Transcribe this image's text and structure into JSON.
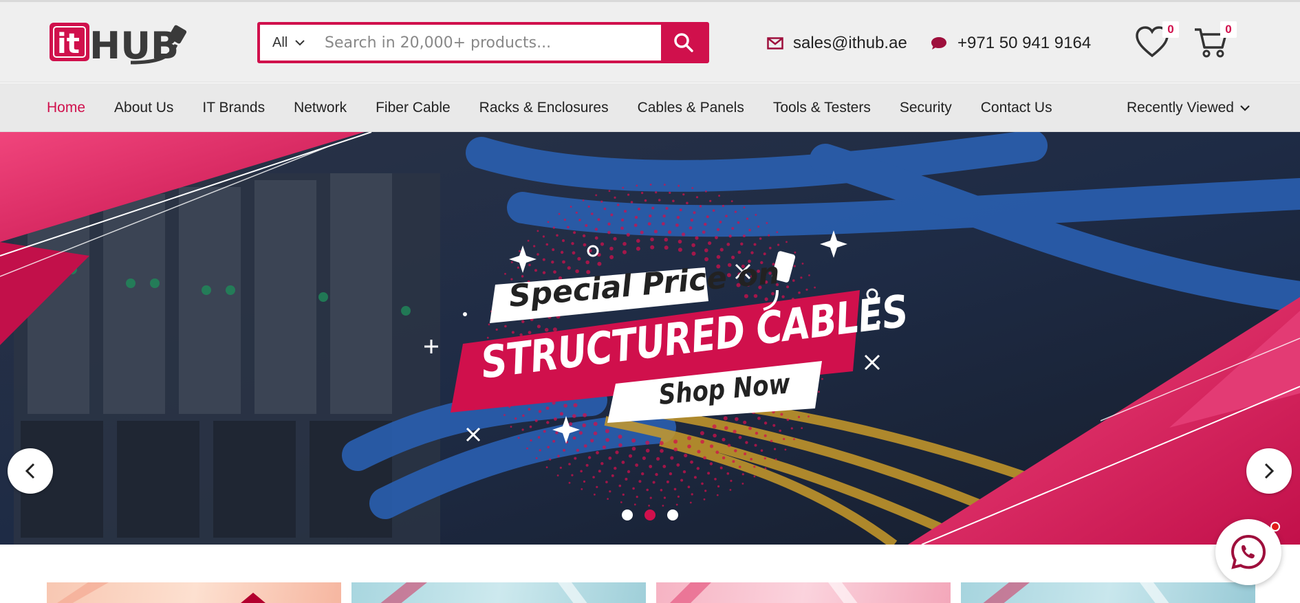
{
  "brand": {
    "logo_text_it": "it",
    "logo_text_hub": "HUB",
    "accent": "#d0104c"
  },
  "search": {
    "category": "All",
    "placeholder": "Search in 20,000+ products...",
    "value": ""
  },
  "contact": {
    "email": "sales@ithub.ae",
    "phone": "+971 50 941 9164"
  },
  "wishlist": {
    "count": "0",
    "icon": "heart-icon"
  },
  "cart": {
    "count": "0",
    "icon": "cart-icon"
  },
  "nav": {
    "items": [
      {
        "label": "Home",
        "active": true
      },
      {
        "label": "About Us"
      },
      {
        "label": "IT Brands"
      },
      {
        "label": "Network"
      },
      {
        "label": "Fiber Cable"
      },
      {
        "label": "Racks & Enclosures"
      },
      {
        "label": "Cables & Panels"
      },
      {
        "label": "Tools & Testers"
      },
      {
        "label": "Security"
      },
      {
        "label": "Contact Us"
      }
    ],
    "recently_viewed": "Recently Viewed"
  },
  "banner": {
    "line1": "Special Price on",
    "line2": "STRUCTURED CABLES",
    "cta": "Shop Now",
    "slides": 3,
    "active_slide": 2
  }
}
